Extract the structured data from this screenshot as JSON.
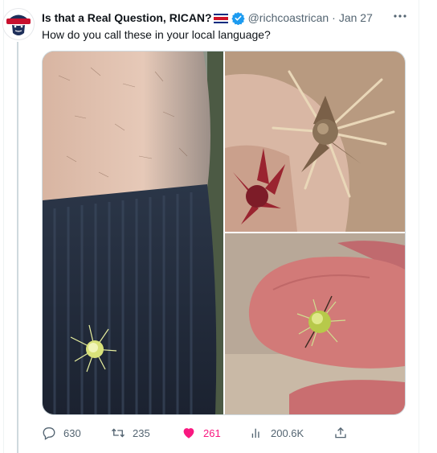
{
  "tweet": {
    "display_name": "Is that a Real Question, RICAN?",
    "handle": "@richcoastrican",
    "separator": "·",
    "date": "Jan 27",
    "text": "How do you call these in your local language?"
  },
  "actions": {
    "replies": "630",
    "reposts": "235",
    "likes": "261",
    "views": "200.6K"
  },
  "icons": {
    "avatar": "bearded-man-logo-avatar",
    "flag": "costa-rica-flag-icon",
    "verified": "verified-badge-icon",
    "more": "more-options-icon",
    "reply": "reply-icon",
    "repost": "repost-icon",
    "like": "heart-icon",
    "views": "views-chart-icon",
    "share": "share-icon"
  },
  "colors": {
    "verified_blue": "#1d9bf0",
    "like_pink": "#f91880",
    "secondary_text": "#536471"
  }
}
